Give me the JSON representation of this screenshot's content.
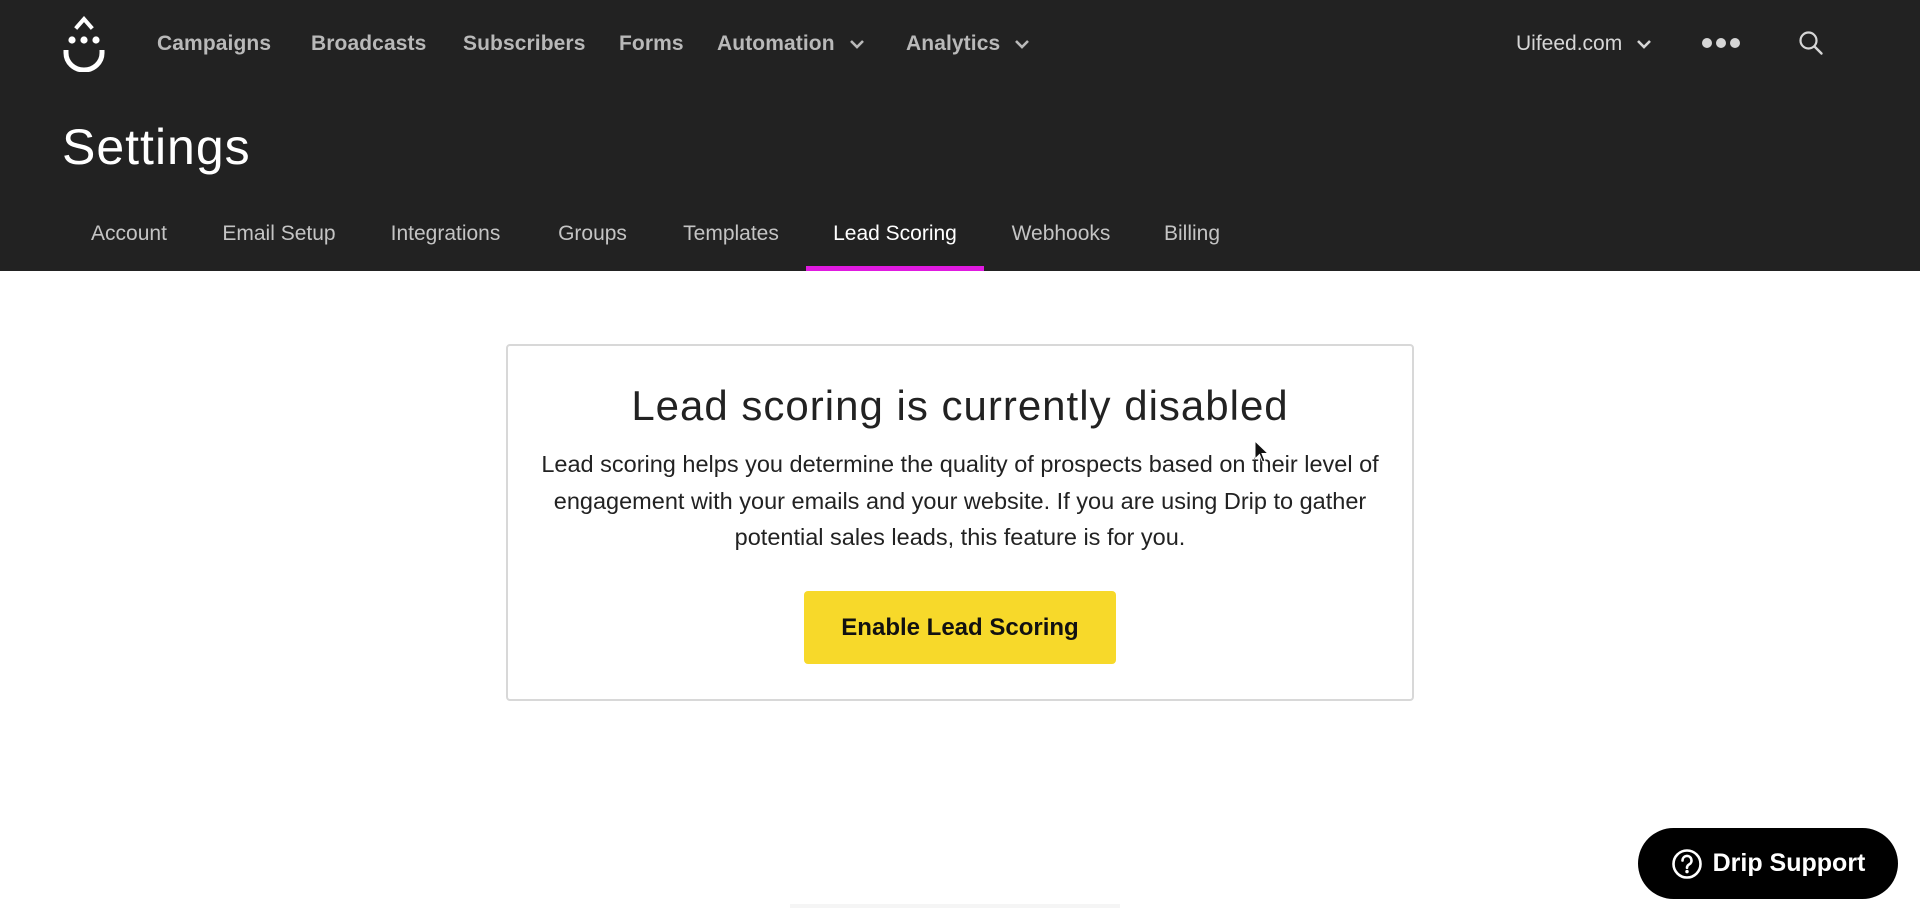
{
  "brand": {
    "logo": "drip-logo-icon",
    "accent_color": "#e01ae0",
    "header_bg": "#222222",
    "cta_color": "#f7d92a"
  },
  "topnav": {
    "items": [
      {
        "label": "Campaigns",
        "has_dropdown": false
      },
      {
        "label": "Broadcasts",
        "has_dropdown": false
      },
      {
        "label": "Subscribers",
        "has_dropdown": false
      },
      {
        "label": "Forms",
        "has_dropdown": false
      },
      {
        "label": "Automation",
        "has_dropdown": true
      },
      {
        "label": "Analytics",
        "has_dropdown": true
      }
    ],
    "account": {
      "label": "Uifeed.com",
      "icon": "chevron-down-icon"
    },
    "more_icon": "more-dots-icon",
    "search_icon": "search-icon"
  },
  "page": {
    "title": "Settings"
  },
  "tabs": [
    {
      "label": "Account",
      "active": false
    },
    {
      "label": "Email Setup",
      "active": false
    },
    {
      "label": "Integrations",
      "active": false
    },
    {
      "label": "Groups",
      "active": false
    },
    {
      "label": "Templates",
      "active": false
    },
    {
      "label": "Lead Scoring",
      "active": true
    },
    {
      "label": "Webhooks",
      "active": false
    },
    {
      "label": "Billing",
      "active": false
    }
  ],
  "lead_scoring": {
    "heading": "Lead scoring is currently disabled",
    "description": "Lead scoring helps you determine the quality of prospects based on their level of engagement with your emails and your website. If you are using Drip to gather potential sales leads, this feature is for you.",
    "enable_button": "Enable Lead Scoring"
  },
  "support": {
    "label": "Drip Support",
    "icon": "help-circle-icon"
  }
}
